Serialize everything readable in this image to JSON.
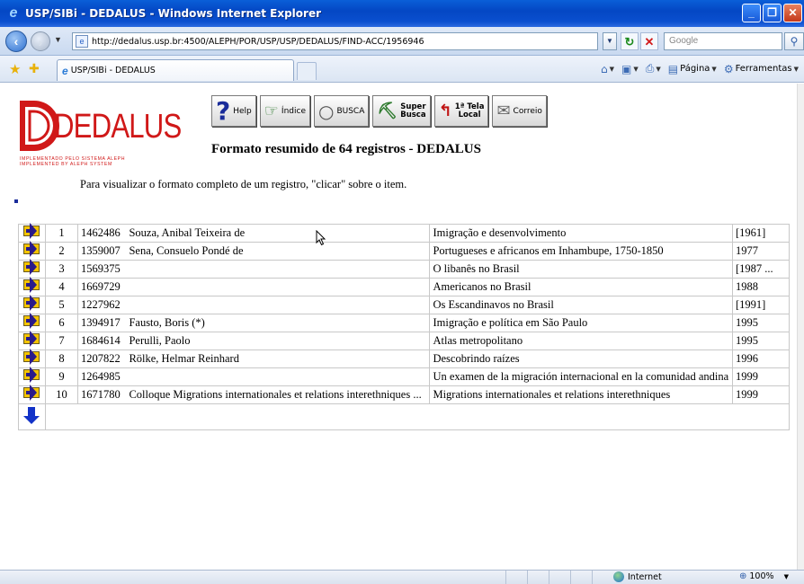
{
  "window": {
    "title": "USP/SIBi - DEDALUS - Windows Internet Explorer",
    "controls": {
      "minimize": "_",
      "maximize": "❐",
      "close": "✕"
    }
  },
  "address_bar": {
    "url": "http://dedalus.usp.br:4500/ALEPH/POR/USP/USP/DEDALUS/FIND-ACC/1956946",
    "search_placeholder": "Google"
  },
  "command_bar": {
    "tab_label": "USP/SIBi - DEDALUS",
    "pagina_label": "Página",
    "ferramentas_label": "Ferramentas"
  },
  "logo": {
    "name": "DEDALUS",
    "tagline_1": "IMPLEMENTADO PELO SISTEMA ALEPH",
    "tagline_2": "IMPLEMENTED BY ALEPH SYSTEM"
  },
  "toolbar": {
    "help": "Help",
    "indice": "Índice",
    "busca": "BUSCA",
    "super_1": "Super",
    "super_2": "Busca",
    "tela_1": "1ª Tela",
    "tela_2": "Local",
    "correio": "Correio"
  },
  "heading": "Formato resumido de 64 registros - DEDALUS",
  "instruction": "Para visualizar o formato completo de um registro, \"clicar\" sobre o item.",
  "records": [
    {
      "num": "1",
      "id": "1462486",
      "author": "Souza, Anibal Teixeira de",
      "title": "Imigração e desenvolvimento",
      "year": "[1961]"
    },
    {
      "num": "2",
      "id": "1359007",
      "author": "Sena, Consuelo Pondé de",
      "title": "Portugueses e africanos em Inhambupe, 1750-1850",
      "year": "1977"
    },
    {
      "num": "3",
      "id": "1569375",
      "author": "",
      "title": "O libanês no Brasil",
      "year": "[1987 ..."
    },
    {
      "num": "4",
      "id": "1669729",
      "author": "",
      "title": "Americanos no Brasil",
      "year": "1988"
    },
    {
      "num": "5",
      "id": "1227962",
      "author": "",
      "title": "Os Escandinavos no Brasil",
      "year": "[1991]"
    },
    {
      "num": "6",
      "id": "1394917",
      "author": "Fausto, Boris (*)",
      "title": "Imigração e política em São Paulo",
      "year": "1995"
    },
    {
      "num": "7",
      "id": "1684614",
      "author": "Perulli, Paolo",
      "title": "Atlas metropolitano",
      "year": "1995"
    },
    {
      "num": "8",
      "id": "1207822",
      "author": "Rölke, Helmar Reinhard",
      "title": "Descobrindo raízes",
      "year": "1996"
    },
    {
      "num": "9",
      "id": "1264985",
      "author": "",
      "title": "Un examen de la migración internacional en la comunidad andina",
      "year": "1999"
    },
    {
      "num": "10",
      "id": "1671780",
      "author": "Colloque Migrations internationales et relations interethniques ...",
      "title": "Migrations internationales et relations interethniques",
      "year": "1999"
    }
  ],
  "status_bar": {
    "zone": "Internet",
    "zoom": "100%"
  }
}
